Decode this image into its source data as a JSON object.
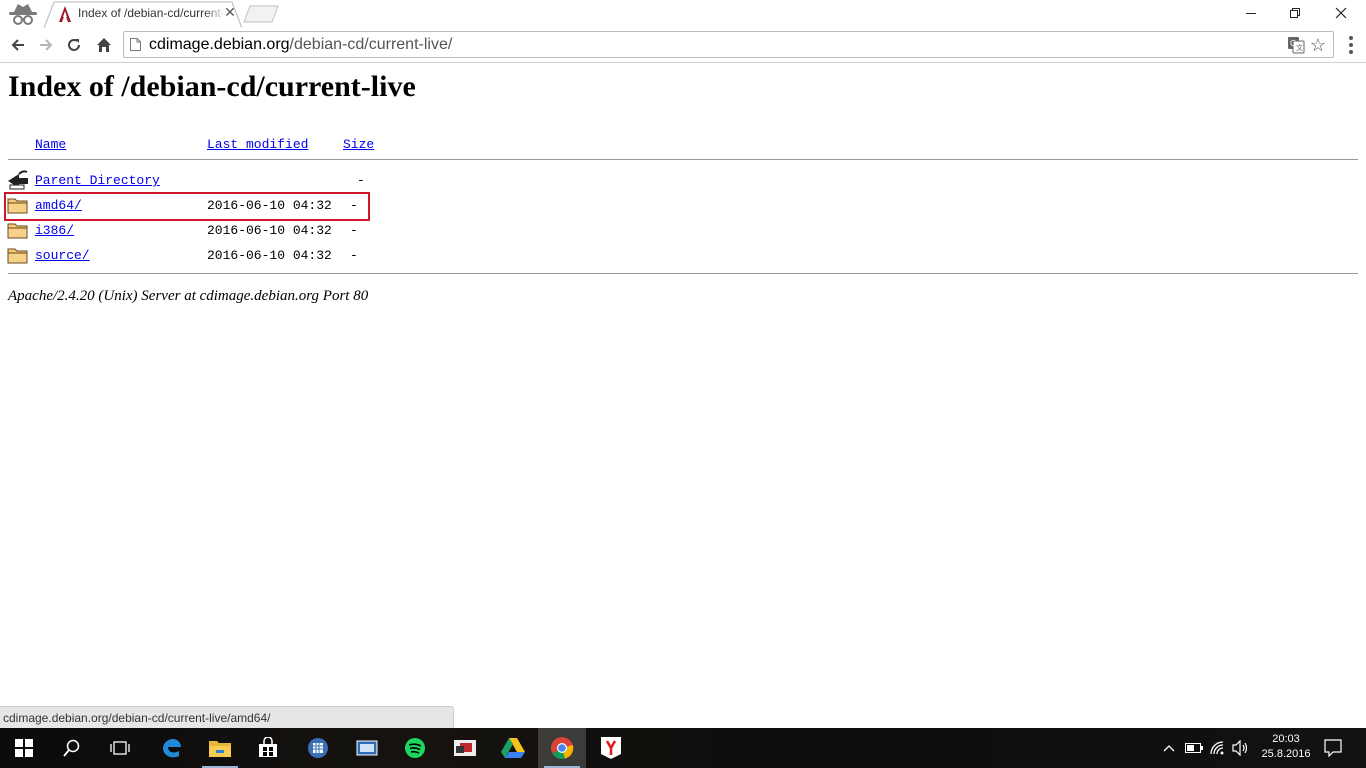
{
  "browser": {
    "tab": {
      "title": "Index of /debian-cd/current-live"
    },
    "omnibox": {
      "host": "cdimage.debian.org",
      "path": "/debian-cd/current-live/"
    },
    "window_controls": {
      "minimize": "—",
      "restore": "❐",
      "close": "✕"
    }
  },
  "page": {
    "heading": "Index of /debian-cd/current-live",
    "columns": {
      "name": "Name",
      "last_modified": "Last modified",
      "size": "Size"
    },
    "rows": [
      {
        "icon": "back-icon",
        "name": "Parent Directory",
        "modified": "",
        "size": "-"
      },
      {
        "icon": "folder-icon",
        "name": "amd64/",
        "modified": "2016-06-10 04:32",
        "size": "-"
      },
      {
        "icon": "folder-icon",
        "name": "i386/",
        "modified": "2016-06-10 04:32",
        "size": "-"
      },
      {
        "icon": "folder-icon",
        "name": "source/",
        "modified": "2016-06-10 04:32",
        "size": "-"
      }
    ],
    "server_signature": "Apache/2.4.20 (Unix) Server at cdimage.debian.org Port 80"
  },
  "status_bar": {
    "url": "cdimage.debian.org/debian-cd/current-live/amd64/"
  },
  "taskbar": {
    "apps": [
      "start-icon",
      "search-icon",
      "task-view-icon",
      "edge-icon",
      "file-explorer-icon",
      "store-icon",
      "app-icon",
      "app-icon-2",
      "spotify-icon",
      "app-icon-3",
      "google-drive-icon",
      "chrome-icon",
      "yandex-icon"
    ],
    "clock": {
      "time": "20:03",
      "date": "25.8.2016"
    }
  },
  "colors": {
    "link": "#0000ee",
    "highlight": "#d0162b",
    "taskbar": "#0f0e0d"
  }
}
